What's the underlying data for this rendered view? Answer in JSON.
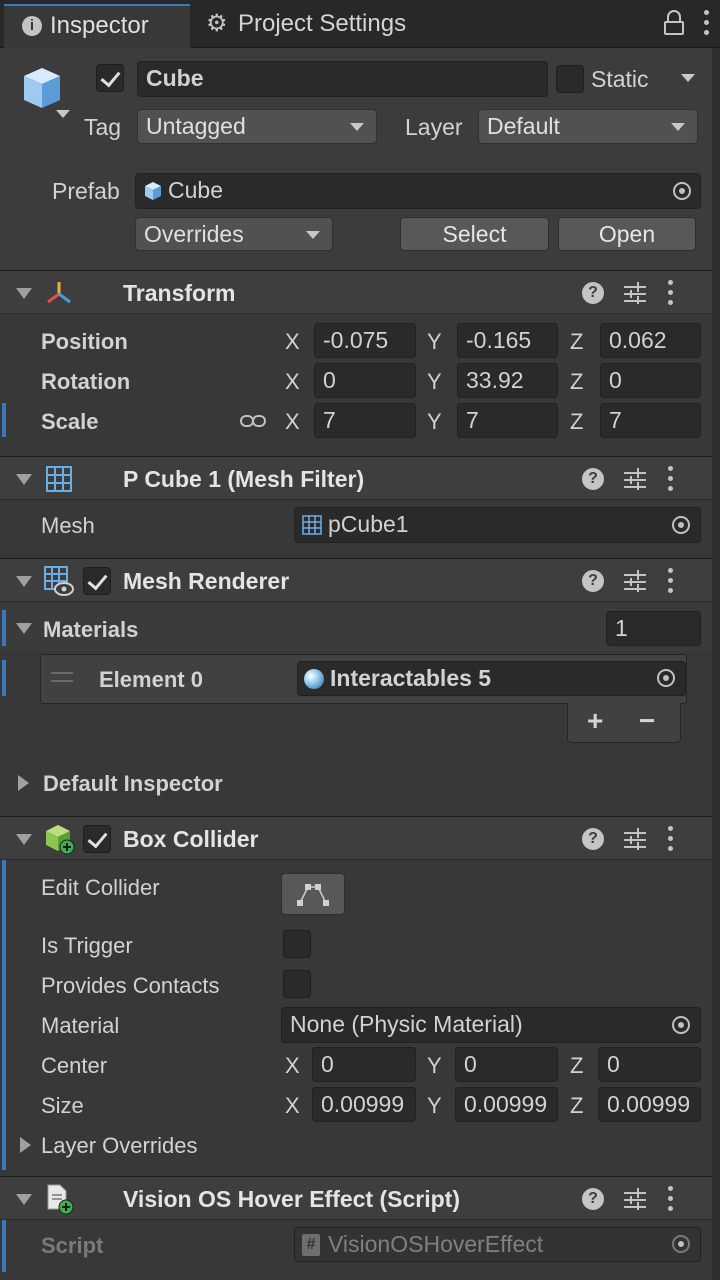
{
  "tabs": [
    {
      "label": "Inspector",
      "active": true
    },
    {
      "label": "Project Settings",
      "active": false
    }
  ],
  "object": {
    "name": "Cube",
    "enabled": true,
    "static_label": "Static",
    "static_checked": false,
    "tag_label": "Tag",
    "tag_value": "Untagged",
    "layer_label": "Layer",
    "layer_value": "Default",
    "prefab_label": "Prefab",
    "prefab_value": "Cube",
    "overrides_label": "Overrides",
    "select_label": "Select",
    "open_label": "Open"
  },
  "transform": {
    "title": "Transform",
    "rows": [
      {
        "label": "Position",
        "x": "-0.075",
        "y": "-0.165",
        "z": "0.062"
      },
      {
        "label": "Rotation",
        "x": "0",
        "y": "33.92",
        "z": "0"
      },
      {
        "label": "Scale",
        "x": "7",
        "y": "7",
        "z": "7"
      }
    ],
    "axis_x": "X",
    "axis_y": "Y",
    "axis_z": "Z"
  },
  "mesh_filter": {
    "title": "P Cube 1 (Mesh Filter)",
    "mesh_label": "Mesh",
    "mesh_value": "pCube1"
  },
  "mesh_renderer": {
    "title": "Mesh Renderer",
    "enabled": true,
    "materials_label": "Materials",
    "materials_count": "1",
    "element_label": "Element 0",
    "element_value": "Interactables 5",
    "add_label": "+",
    "remove_label": "−",
    "default_inspector_label": "Default Inspector"
  },
  "box_collider": {
    "title": "Box Collider",
    "enabled": true,
    "edit_collider_label": "Edit Collider",
    "is_trigger_label": "Is Trigger",
    "provides_contacts_label": "Provides Contacts",
    "material_label": "Material",
    "material_value": "None (Physic Material)",
    "center_label": "Center",
    "center": {
      "x": "0",
      "y": "0",
      "z": "0"
    },
    "size_label": "Size",
    "size": {
      "x": "0.00999",
      "y": "0.00999",
      "z": "0.00999"
    },
    "layer_overrides_label": "Layer Overrides"
  },
  "hover_script": {
    "title": "Vision OS Hover Effect (Script)",
    "script_label": "Script",
    "script_value": "VisionOSHoverEffect"
  },
  "colors": {
    "background": "#383838",
    "accent_bar": "#3a79bb",
    "field": "#2a2a2a"
  }
}
